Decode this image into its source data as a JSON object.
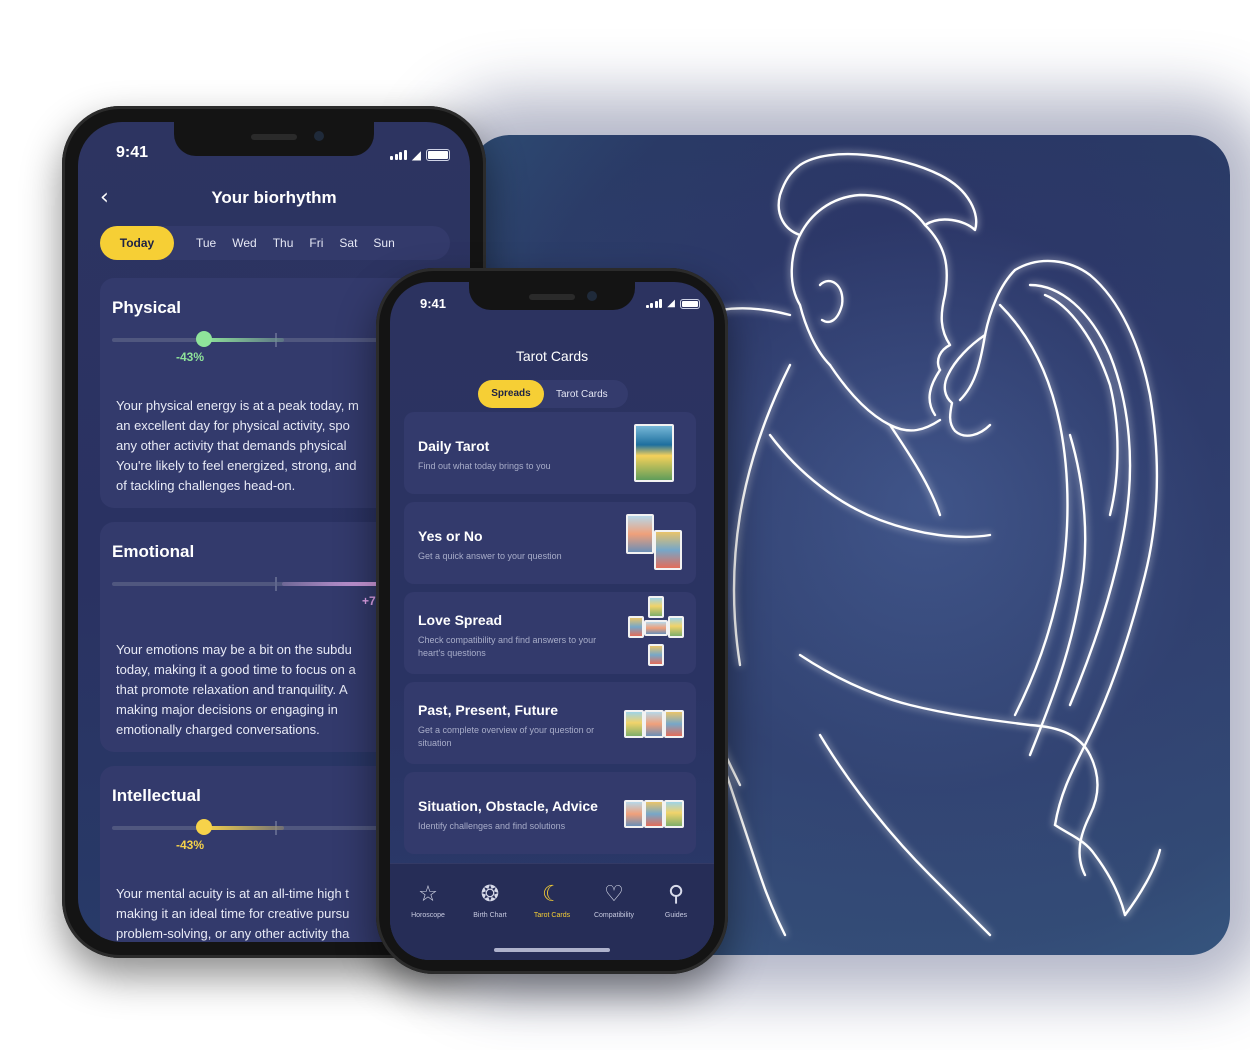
{
  "phone1": {
    "status_time": "9:41",
    "title": "Your biorhythm",
    "days": [
      "Today",
      "Tue",
      "Wed",
      "Thu",
      "Fri",
      "Sat",
      "Sun"
    ],
    "sections": [
      {
        "title": "Physical",
        "percent": "-43%",
        "text": [
          "Your physical energy is at a peak today, m",
          "an excellent day for physical activity, spo",
          "any other activity that demands physical",
          "You're likely to feel energized, strong, and",
          "of tackling challenges head-on."
        ],
        "color": "#8fe39a"
      },
      {
        "title": "Emotional",
        "percent": "+7",
        "text": [
          "Your emotions may be a bit on the subdu",
          "today, making it a good time to focus on a",
          "that promote relaxation and tranquility. A",
          "making major decisions or engaging in",
          "emotionally charged conversations."
        ],
        "color": "#e7a8f0"
      },
      {
        "title": "Intellectual",
        "percent": "-43%",
        "text": [
          "Your mental acuity is at an all-time high t",
          "making it an ideal time for creative pursu",
          "problem-solving, or any other activity tha"
        ],
        "color": "#f6d24a"
      }
    ]
  },
  "phone2": {
    "status_time": "9:41",
    "title": "Tarot Cards",
    "segments": [
      "Spreads",
      "Tarot Cards"
    ],
    "cards": [
      {
        "name": "Daily Tarot",
        "desc": "Find out what today brings to you"
      },
      {
        "name": "Yes or No",
        "desc": "Get a quick answer to your question"
      },
      {
        "name": "Love Spread",
        "desc": "Check compatibility and find answers to your heart's questions"
      },
      {
        "name": "Past, Present, Future",
        "desc": "Get a complete overview of your question or situation"
      },
      {
        "name": "Situation, Obstacle, Advice",
        "desc": "Identify challenges and find solutions"
      }
    ],
    "tabs": [
      {
        "label": "Horoscope",
        "icon": "star-icon"
      },
      {
        "label": "Birth Chart",
        "icon": "chart-wheel-icon"
      },
      {
        "label": "Tarot Cards",
        "icon": "tarot-card-icon",
        "active": true
      },
      {
        "label": "Compatibility",
        "icon": "hearts-icon"
      },
      {
        "label": "Guides",
        "icon": "search-icon"
      }
    ]
  },
  "colors": {
    "accent": "#f6cf35",
    "background": "#2b3364",
    "card": "#333a6c"
  }
}
